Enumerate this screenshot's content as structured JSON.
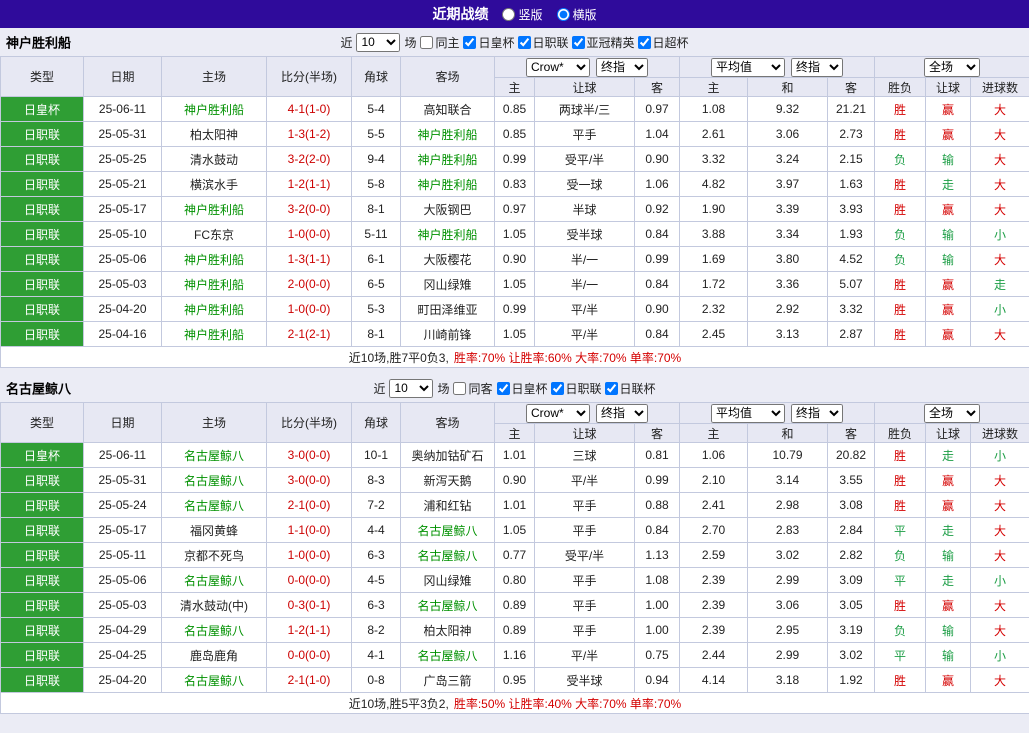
{
  "colors": {
    "topbar_bg": "#2f0b9b",
    "band_bg": "#ebecf5",
    "header_bg": "#e7e8f3",
    "grid_border": "#c3c9de",
    "type_bg": "#2f9e34",
    "focal_green": "#009100",
    "result_red": "#d40000",
    "result_green": "#1d9e46",
    "score_red": "#cc0000"
  },
  "topbar": {
    "title": "近期战绩",
    "options": [
      {
        "label": "竖版",
        "checked": false
      },
      {
        "label": "横版",
        "checked": true
      }
    ]
  },
  "table_header": {
    "col_type": "类型",
    "col_date": "日期",
    "col_home": "主场",
    "col_score": "比分(半场)",
    "col_corner": "角球",
    "col_away": "客场",
    "odds_select": "Crow*",
    "odds_select2": "终指",
    "avg_select": "平均值",
    "avg_select2": "终指",
    "full_select": "全场",
    "sub_home": "主",
    "sub_handicap": "让球",
    "sub_away": "客",
    "sub_avg_home": "主",
    "sub_draw": "和",
    "sub_avg_away": "客",
    "sub_result": "胜负",
    "sub_handicap_result": "让球",
    "sub_goals": "进球数"
  },
  "sections": [
    {
      "team": "神户胜利船",
      "filter": {
        "near_label": "近",
        "rounds": "10",
        "games_label": "场",
        "same_label": "同主",
        "same_checked": false,
        "competitions": [
          {
            "label": "日皇杯",
            "checked": true
          },
          {
            "label": "日职联",
            "checked": true
          },
          {
            "label": "亚冠精英",
            "checked": true
          },
          {
            "label": "日超杯",
            "checked": true
          }
        ]
      },
      "rows": [
        {
          "type": "日皇杯",
          "date": "25-06-11",
          "home": {
            "name": "神户胜利船",
            "cls": "focal"
          },
          "score": "4-1(1-0)",
          "corner": "5-4",
          "away": {
            "name": "高知联合",
            "cls": "norm"
          },
          "odds_home": "0.85",
          "handicap": "两球半/三",
          "odds_away": "0.97",
          "avg_home": "1.08",
          "avg_draw": "9.32",
          "avg_away": "21.21",
          "res_outcome": {
            "t": "胜",
            "c": "red"
          },
          "res_handicap": {
            "t": "赢",
            "c": "red"
          },
          "res_goals": {
            "t": "大",
            "c": "red"
          }
        },
        {
          "type": "日职联",
          "date": "25-05-31",
          "home": {
            "name": "柏太阳神",
            "cls": "norm"
          },
          "score": "1-3(1-2)",
          "corner": "5-5",
          "away": {
            "name": "神户胜利船",
            "cls": "focal"
          },
          "odds_home": "0.85",
          "handicap": "平手",
          "odds_away": "1.04",
          "avg_home": "2.61",
          "avg_draw": "3.06",
          "avg_away": "2.73",
          "res_outcome": {
            "t": "胜",
            "c": "red"
          },
          "res_handicap": {
            "t": "赢",
            "c": "red"
          },
          "res_goals": {
            "t": "大",
            "c": "red"
          }
        },
        {
          "type": "日职联",
          "date": "25-05-25",
          "home": {
            "name": "清水鼓动",
            "cls": "norm"
          },
          "score": "3-2(2-0)",
          "corner": "9-4",
          "away": {
            "name": "神户胜利船",
            "cls": "focal"
          },
          "odds_home": "0.99",
          "handicap": "受平/半",
          "odds_away": "0.90",
          "avg_home": "3.32",
          "avg_draw": "3.24",
          "avg_away": "2.15",
          "res_outcome": {
            "t": "负",
            "c": "green"
          },
          "res_handicap": {
            "t": "输",
            "c": "green"
          },
          "res_goals": {
            "t": "大",
            "c": "red"
          }
        },
        {
          "type": "日职联",
          "date": "25-05-21",
          "home": {
            "name": "横滨水手",
            "cls": "norm"
          },
          "score": "1-2(1-1)",
          "corner": "5-8",
          "away": {
            "name": "神户胜利船",
            "cls": "focal"
          },
          "odds_home": "0.83",
          "handicap": "受一球",
          "odds_away": "1.06",
          "avg_home": "4.82",
          "avg_draw": "3.97",
          "avg_away": "1.63",
          "res_outcome": {
            "t": "胜",
            "c": "red"
          },
          "res_handicap": {
            "t": "走",
            "c": "green"
          },
          "res_goals": {
            "t": "大",
            "c": "red"
          }
        },
        {
          "type": "日职联",
          "date": "25-05-17",
          "home": {
            "name": "神户胜利船",
            "cls": "focal"
          },
          "score": "3-2(0-0)",
          "corner": "8-1",
          "away": {
            "name": "大阪钢巴",
            "cls": "norm"
          },
          "odds_home": "0.97",
          "handicap": "半球",
          "odds_away": "0.92",
          "avg_home": "1.90",
          "avg_draw": "3.39",
          "avg_away": "3.93",
          "res_outcome": {
            "t": "胜",
            "c": "red"
          },
          "res_handicap": {
            "t": "赢",
            "c": "red"
          },
          "res_goals": {
            "t": "大",
            "c": "red"
          }
        },
        {
          "type": "日职联",
          "date": "25-05-10",
          "home": {
            "name": "FC东京",
            "cls": "norm"
          },
          "score": "1-0(0-0)",
          "corner": "5-11",
          "away": {
            "name": "神户胜利船",
            "cls": "focal"
          },
          "odds_home": "1.05",
          "handicap": "受半球",
          "odds_away": "0.84",
          "avg_home": "3.88",
          "avg_draw": "3.34",
          "avg_away": "1.93",
          "res_outcome": {
            "t": "负",
            "c": "green"
          },
          "res_handicap": {
            "t": "输",
            "c": "green"
          },
          "res_goals": {
            "t": "小",
            "c": "green"
          }
        },
        {
          "type": "日职联",
          "date": "25-05-06",
          "home": {
            "name": "神户胜利船",
            "cls": "focal"
          },
          "score": "1-3(1-1)",
          "corner": "6-1",
          "away": {
            "name": "大阪樱花",
            "cls": "norm"
          },
          "odds_home": "0.90",
          "handicap": "半/一",
          "odds_away": "0.99",
          "avg_home": "1.69",
          "avg_draw": "3.80",
          "avg_away": "4.52",
          "res_outcome": {
            "t": "负",
            "c": "green"
          },
          "res_handicap": {
            "t": "输",
            "c": "green"
          },
          "res_goals": {
            "t": "大",
            "c": "red"
          }
        },
        {
          "type": "日职联",
          "date": "25-05-03",
          "home": {
            "name": "神户胜利船",
            "cls": "focal"
          },
          "score": "2-0(0-0)",
          "corner": "6-5",
          "away": {
            "name": "冈山绿雉",
            "cls": "norm"
          },
          "odds_home": "1.05",
          "handicap": "半/一",
          "odds_away": "0.84",
          "avg_home": "1.72",
          "avg_draw": "3.36",
          "avg_away": "5.07",
          "res_outcome": {
            "t": "胜",
            "c": "red"
          },
          "res_handicap": {
            "t": "赢",
            "c": "red"
          },
          "res_goals": {
            "t": "走",
            "c": "green"
          }
        },
        {
          "type": "日职联",
          "date": "25-04-20",
          "home": {
            "name": "神户胜利船",
            "cls": "focal"
          },
          "score": "1-0(0-0)",
          "corner": "5-3",
          "away": {
            "name": "町田泽维亚",
            "cls": "norm"
          },
          "odds_home": "0.99",
          "handicap": "平/半",
          "odds_away": "0.90",
          "avg_home": "2.32",
          "avg_draw": "2.92",
          "avg_away": "3.32",
          "res_outcome": {
            "t": "胜",
            "c": "red"
          },
          "res_handicap": {
            "t": "赢",
            "c": "red"
          },
          "res_goals": {
            "t": "小",
            "c": "green"
          }
        },
        {
          "type": "日职联",
          "date": "25-04-16",
          "home": {
            "name": "神户胜利船",
            "cls": "focal"
          },
          "score": "2-1(2-1)",
          "corner": "8-1",
          "away": {
            "name": "川崎前锋",
            "cls": "norm"
          },
          "odds_home": "1.05",
          "handicap": "平/半",
          "odds_away": "0.84",
          "avg_home": "2.45",
          "avg_draw": "3.13",
          "avg_away": "2.87",
          "res_outcome": {
            "t": "胜",
            "c": "red"
          },
          "res_handicap": {
            "t": "赢",
            "c": "red"
          },
          "res_goals": {
            "t": "大",
            "c": "red"
          }
        }
      ],
      "summary": {
        "plain": "近10场,胜7平0负3,",
        "rates": "胜率:70% 让胜率:60% 大率:70% 单率:70%"
      }
    },
    {
      "team": "名古屋鲸八",
      "filter": {
        "near_label": "近",
        "rounds": "10",
        "games_label": "场",
        "same_label": "同客",
        "same_checked": false,
        "competitions": [
          {
            "label": "日皇杯",
            "checked": true
          },
          {
            "label": "日职联",
            "checked": true
          },
          {
            "label": "日联杯",
            "checked": true
          }
        ]
      },
      "rows": [
        {
          "type": "日皇杯",
          "date": "25-06-11",
          "home": {
            "name": "名古屋鲸八",
            "cls": "focal"
          },
          "score": "3-0(0-0)",
          "corner": "10-1",
          "away": {
            "name": "奥纳加钴矿石",
            "cls": "norm"
          },
          "odds_home": "1.01",
          "handicap": "三球",
          "odds_away": "0.81",
          "avg_home": "1.06",
          "avg_draw": "10.79",
          "avg_away": "20.82",
          "res_outcome": {
            "t": "胜",
            "c": "red"
          },
          "res_handicap": {
            "t": "走",
            "c": "green"
          },
          "res_goals": {
            "t": "小",
            "c": "green"
          }
        },
        {
          "type": "日职联",
          "date": "25-05-31",
          "home": {
            "name": "名古屋鲸八",
            "cls": "focal"
          },
          "score": "3-0(0-0)",
          "corner": "8-3",
          "away": {
            "name": "新泻天鹅",
            "cls": "norm"
          },
          "odds_home": "0.90",
          "handicap": "平/半",
          "odds_away": "0.99",
          "avg_home": "2.10",
          "avg_draw": "3.14",
          "avg_away": "3.55",
          "res_outcome": {
            "t": "胜",
            "c": "red"
          },
          "res_handicap": {
            "t": "赢",
            "c": "red"
          },
          "res_goals": {
            "t": "大",
            "c": "red"
          }
        },
        {
          "type": "日职联",
          "date": "25-05-24",
          "home": {
            "name": "名古屋鲸八",
            "cls": "focal"
          },
          "score": "2-1(0-0)",
          "corner": "7-2",
          "away": {
            "name": "浦和红钻",
            "cls": "norm"
          },
          "odds_home": "1.01",
          "handicap": "平手",
          "odds_away": "0.88",
          "avg_home": "2.41",
          "avg_draw": "2.98",
          "avg_away": "3.08",
          "res_outcome": {
            "t": "胜",
            "c": "red"
          },
          "res_handicap": {
            "t": "赢",
            "c": "red"
          },
          "res_goals": {
            "t": "大",
            "c": "red"
          }
        },
        {
          "type": "日职联",
          "date": "25-05-17",
          "home": {
            "name": "福冈黄蜂",
            "cls": "norm"
          },
          "score": "1-1(0-0)",
          "corner": "4-4",
          "away": {
            "name": "名古屋鲸八",
            "cls": "focal"
          },
          "odds_home": "1.05",
          "handicap": "平手",
          "odds_away": "0.84",
          "avg_home": "2.70",
          "avg_draw": "2.83",
          "avg_away": "2.84",
          "res_outcome": {
            "t": "平",
            "c": "green"
          },
          "res_handicap": {
            "t": "走",
            "c": "green"
          },
          "res_goals": {
            "t": "大",
            "c": "red"
          }
        },
        {
          "type": "日职联",
          "date": "25-05-11",
          "home": {
            "name": "京都不死鸟",
            "cls": "norm"
          },
          "score": "1-0(0-0)",
          "corner": "6-3",
          "away": {
            "name": "名古屋鲸八",
            "cls": "focal"
          },
          "odds_home": "0.77",
          "handicap": "受平/半",
          "odds_away": "1.13",
          "avg_home": "2.59",
          "avg_draw": "3.02",
          "avg_away": "2.82",
          "res_outcome": {
            "t": "负",
            "c": "green"
          },
          "res_handicap": {
            "t": "输",
            "c": "green"
          },
          "res_goals": {
            "t": "大",
            "c": "red"
          }
        },
        {
          "type": "日职联",
          "date": "25-05-06",
          "home": {
            "name": "名古屋鲸八",
            "cls": "focal"
          },
          "score": "0-0(0-0)",
          "corner": "4-5",
          "away": {
            "name": "冈山绿雉",
            "cls": "norm"
          },
          "odds_home": "0.80",
          "handicap": "平手",
          "odds_away": "1.08",
          "avg_home": "2.39",
          "avg_draw": "2.99",
          "avg_away": "3.09",
          "res_outcome": {
            "t": "平",
            "c": "green"
          },
          "res_handicap": {
            "t": "走",
            "c": "green"
          },
          "res_goals": {
            "t": "小",
            "c": "green"
          }
        },
        {
          "type": "日职联",
          "date": "25-05-03",
          "home": {
            "name": "清水鼓动(中)",
            "cls": "norm"
          },
          "score": "0-3(0-1)",
          "corner": "6-3",
          "away": {
            "name": "名古屋鲸八",
            "cls": "focal"
          },
          "odds_home": "0.89",
          "handicap": "平手",
          "odds_away": "1.00",
          "avg_home": "2.39",
          "avg_draw": "3.06",
          "avg_away": "3.05",
          "res_outcome": {
            "t": "胜",
            "c": "red"
          },
          "res_handicap": {
            "t": "赢",
            "c": "red"
          },
          "res_goals": {
            "t": "大",
            "c": "red"
          }
        },
        {
          "type": "日职联",
          "date": "25-04-29",
          "home": {
            "name": "名古屋鲸八",
            "cls": "focal"
          },
          "score": "1-2(1-1)",
          "corner": "8-2",
          "away": {
            "name": "柏太阳神",
            "cls": "norm"
          },
          "odds_home": "0.89",
          "handicap": "平手",
          "odds_away": "1.00",
          "avg_home": "2.39",
          "avg_draw": "2.95",
          "avg_away": "3.19",
          "res_outcome": {
            "t": "负",
            "c": "green"
          },
          "res_handicap": {
            "t": "输",
            "c": "green"
          },
          "res_goals": {
            "t": "大",
            "c": "red"
          }
        },
        {
          "type": "日职联",
          "date": "25-04-25",
          "home": {
            "name": "鹿岛鹿角",
            "cls": "norm"
          },
          "score": "0-0(0-0)",
          "corner": "4-1",
          "away": {
            "name": "名古屋鲸八",
            "cls": "focal"
          },
          "odds_home": "1.16",
          "handicap": "平/半",
          "odds_away": "0.75",
          "avg_home": "2.44",
          "avg_draw": "2.99",
          "avg_away": "3.02",
          "res_outcome": {
            "t": "平",
            "c": "green"
          },
          "res_handicap": {
            "t": "输",
            "c": "green"
          },
          "res_goals": {
            "t": "小",
            "c": "green"
          }
        },
        {
          "type": "日职联",
          "date": "25-04-20",
          "home": {
            "name": "名古屋鲸八",
            "cls": "focal"
          },
          "score": "2-1(1-0)",
          "corner": "0-8",
          "away": {
            "name": "广岛三箭",
            "cls": "norm"
          },
          "odds_home": "0.95",
          "handicap": "受半球",
          "odds_away": "0.94",
          "avg_home": "4.14",
          "avg_draw": "3.18",
          "avg_away": "1.92",
          "res_outcome": {
            "t": "胜",
            "c": "red"
          },
          "res_handicap": {
            "t": "赢",
            "c": "red"
          },
          "res_goals": {
            "t": "大",
            "c": "red"
          }
        }
      ],
      "summary": {
        "plain": "近10场,胜5平3负2,",
        "rates": "胜率:50% 让胜率:40% 大率:70% 单率:70%"
      }
    }
  ]
}
